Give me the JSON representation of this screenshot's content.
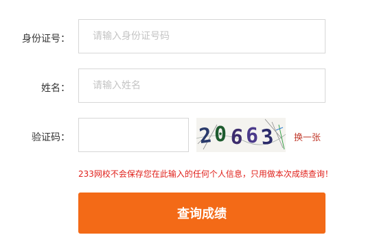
{
  "form": {
    "id_number": {
      "label": "身份证号：",
      "value": "",
      "placeholder": "请输入身份证号码"
    },
    "name": {
      "label": "姓名：",
      "value": "",
      "placeholder": "请输入姓名"
    },
    "captcha": {
      "label": "验证码：",
      "value": "",
      "placeholder": "",
      "image_text": "20663",
      "refresh_label": "换一张"
    },
    "notice": "233网校不会保存您在此输入的任何个人信息，只用做本次成绩查询！",
    "submit_label": "查询成绩"
  },
  "colors": {
    "accent": "#f36a17",
    "notice_text": "#e0201b",
    "refresh_link": "#c0392b",
    "input_border": "#d6d6d6",
    "placeholder": "#c4c4c4"
  }
}
